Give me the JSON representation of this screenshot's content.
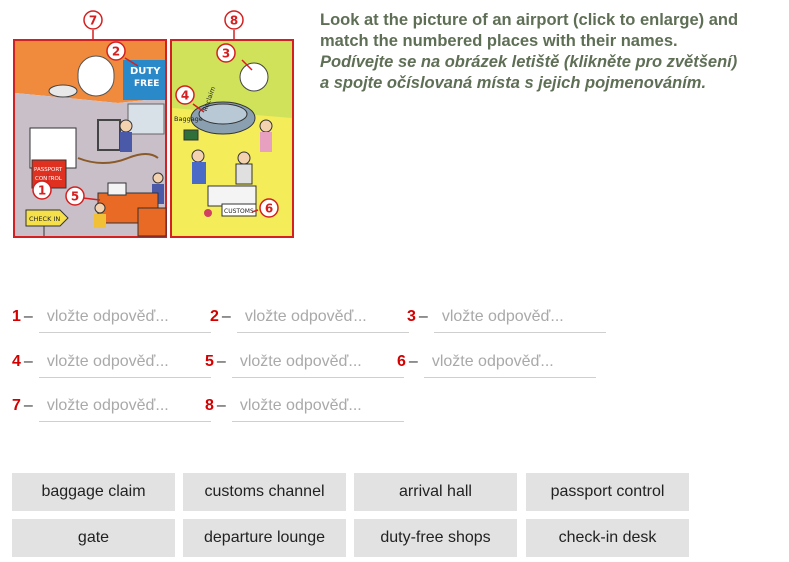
{
  "illustration": {
    "signs": {
      "duty": "DUTY",
      "free": "FREE",
      "passport": "PASSPORT",
      "control": "CONTROL",
      "checkin": "CHECK IN",
      "baggage": "Baggage",
      "reclaim": "Reclaim",
      "customs": "CUSTOMS"
    },
    "markers": [
      "7",
      "8",
      "2",
      "3",
      "4",
      "1",
      "5",
      "6"
    ]
  },
  "instructions": {
    "en_line1": "Look at the picture of an airport (click to enlarge) and",
    "en_line2": "match the numbered places with their names.",
    "cz_line1": "Podívejte se na obrázek letiště (klikněte pro zvětšení)",
    "cz_line2": "a spojte očíslovaná místa s jejich pojmenováním."
  },
  "answers": {
    "placeholder": "vložte odpověď...",
    "dash": "–",
    "slots": [
      {
        "number": "1",
        "value": ""
      },
      {
        "number": "2",
        "value": ""
      },
      {
        "number": "3",
        "value": ""
      },
      {
        "number": "4",
        "value": ""
      },
      {
        "number": "5",
        "value": ""
      },
      {
        "number": "6",
        "value": ""
      },
      {
        "number": "7",
        "value": ""
      },
      {
        "number": "8",
        "value": ""
      }
    ]
  },
  "word_bank": [
    "baggage claim",
    "customs channel",
    "arrival hall",
    "passport control",
    "gate",
    "departure lounge",
    "duty-free shops",
    "check-in desk"
  ],
  "colors": {
    "accent_red": "#d40000",
    "instruction_text": "#5f6f56",
    "chip_background": "#e2e2e2"
  }
}
